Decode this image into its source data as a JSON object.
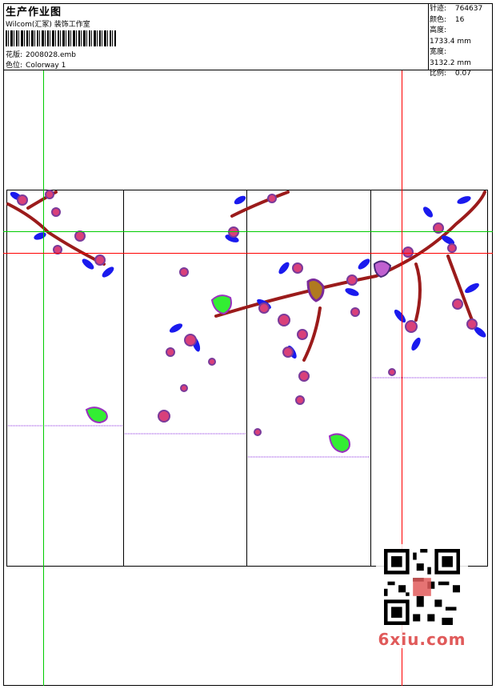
{
  "header": {
    "title": "生产作业图",
    "studio": "Wilcom(汇冢) 装饰工作室",
    "pattern_label": "花版:",
    "pattern_value": "2008028.emb",
    "colorway_label": "色位:",
    "colorway_value": "Colorway 1"
  },
  "stats": [
    {
      "label": "针迹:",
      "value": "764637"
    },
    {
      "label": "颜色:",
      "value": "16"
    },
    {
      "label": "高度:",
      "value": "1733.4 mm"
    },
    {
      "label": "宽度:",
      "value": "3132.2 mm"
    },
    {
      "label": "比例:",
      "value": "0.07"
    }
  ],
  "colors": {
    "guide_green": "#00cc00",
    "guide_red": "#ff0000",
    "branch": "#9b1b1b",
    "leaf": "#1a1aee",
    "flower": "#d9407a",
    "dotted_line": "#8a2be2",
    "watermark": "#e05a5a"
  },
  "panels": 4,
  "watermark": {
    "text": "6xiu.com"
  }
}
